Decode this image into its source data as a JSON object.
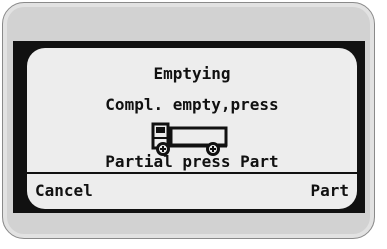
{
  "screen": {
    "title": "Emptying",
    "message_line_1": "Compl. empty,press",
    "message_line_2": "Partial press Part",
    "icon": "truck-icon"
  },
  "softkeys": {
    "left_label": "Cancel",
    "right_label": "Part"
  },
  "colors": {
    "bezel": "#d2d2d2",
    "lcd_frame": "#111111",
    "lcd_background": "#ededed",
    "lcd_text": "#111111"
  }
}
